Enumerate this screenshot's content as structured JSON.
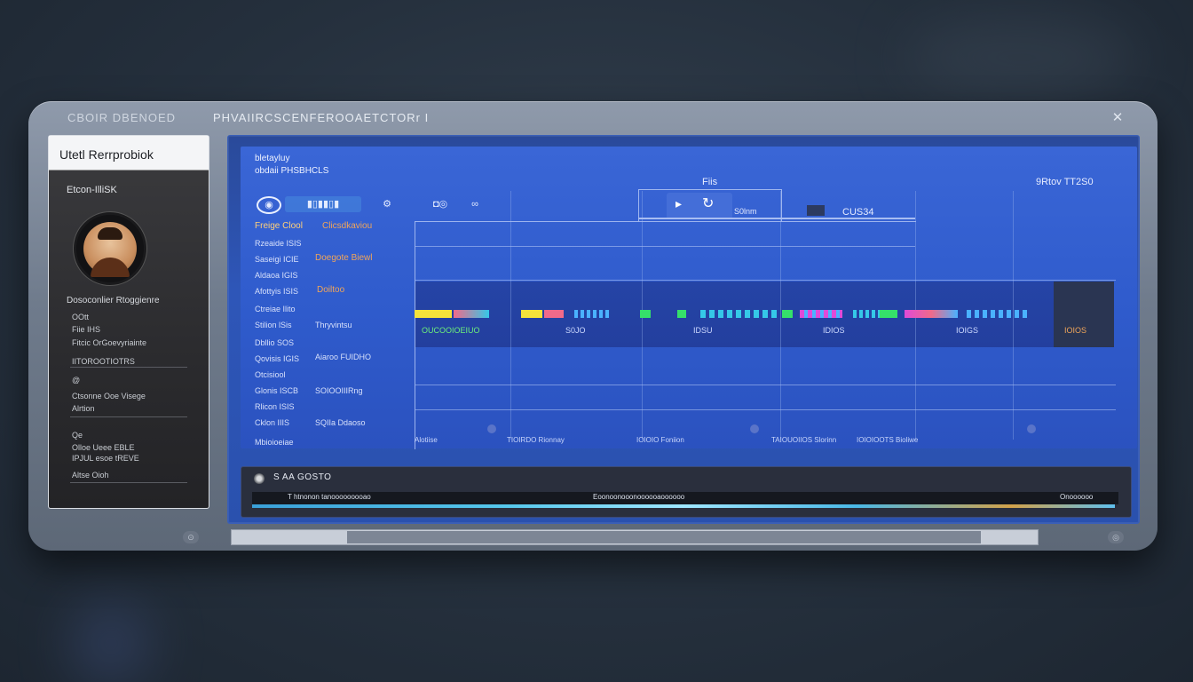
{
  "window": {
    "left_title": "CBOIR DBENOED",
    "title": "PHVAIIRCSCENFEROOAETCTORr I",
    "close_icon": "close-icon"
  },
  "profile": {
    "header": "Utetl Rerrprobiok",
    "name": "Etcon-IlliSK",
    "rows": [
      "Dosoconlier Rtoggienre",
      "OOtt",
      "Fiie IHS",
      "Fitcic OrGoevyriainte",
      "IITOROOTIOTRS",
      "@",
      "Ctsonne Ooe Visege",
      "Alrtion",
      "Qe",
      "Olloe Ueee EBLE",
      "IPJUL esoe tREVE",
      "Altse Oioh"
    ]
  },
  "main": {
    "top_left_1": "bletayluy",
    "top_left_2": "obdaii PHSBHCLS",
    "top_right": "9Rtov TT2S0",
    "mid_label_1": "Fiis",
    "mid_label_2": "S0lnm",
    "mid_label_3": "CUS34",
    "side_items": [
      {
        "left": "Freige Clool",
        "right": "Clicsdkaviou"
      },
      {
        "left": "Rzeaide ISIS",
        "right": ""
      },
      {
        "left": "Saseigi ICIE",
        "right": "Doegote Biewl"
      },
      {
        "left": "Aldaoa IGIS",
        "right": ""
      },
      {
        "left": "Afottyis ISIS",
        "right": "Doiltoo"
      },
      {
        "left": "Ctreiae Ilito",
        "right": ""
      },
      {
        "left": "Stilion lSis",
        "right": "Thryvintsu"
      },
      {
        "left": "Dbllio SOS",
        "right": ""
      },
      {
        "left": "Qovisis IGIS",
        "right": "Aiaroo FUIDHO"
      },
      {
        "left": "Otcisiool",
        "right": ""
      },
      {
        "left": "Glonis ISCB",
        "right": "SOIOOIIIRng"
      },
      {
        "left": "Rlicon ISIS",
        "right": ""
      },
      {
        "left": "Cklon IIIS",
        "right": "SQIIa Ddaoso"
      },
      {
        "left": "Mbioioeiae",
        "right": ""
      }
    ],
    "band_labels": [
      "OUCOOIOEIUO",
      "S0JO",
      "IDSU",
      "IDIOS",
      "IOIGS",
      "IOIOS"
    ],
    "bottom_labels": [
      "Alotiise",
      "TIOIRDO Rionnay",
      "IOIOIO Foniion",
      "TAIOUOIIOS Slorinn",
      "IOIOIOOTS Bioliwe"
    ],
    "strip_colors": [
      "#f5e33a",
      "#f06a8a",
      "#35c8e8",
      "#35e06a",
      "#e04ad8",
      "#4ab2ff",
      "#ff7a3a",
      "#6df0e8"
    ]
  },
  "timeline": {
    "title": "S AA GOSTO",
    "labels": [
      "T htnonon tanooooooooao",
      "Eoonoonooonoooooaoooooo",
      "Onoooooo"
    ]
  }
}
